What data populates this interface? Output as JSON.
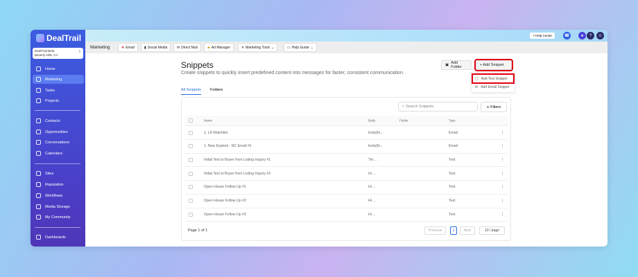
{
  "app": {
    "name": "DealTrail",
    "account_name": "DealTrail Beta",
    "account_location": "Beverly Hills, CA"
  },
  "sidebar": {
    "items": [
      {
        "label": "Home"
      },
      {
        "label": "Marketing"
      },
      {
        "label": "Tasks"
      },
      {
        "label": "Projects"
      },
      {
        "label": "Contacts"
      },
      {
        "label": "Opportunities"
      },
      {
        "label": "Conversations"
      },
      {
        "label": "Calendars"
      },
      {
        "label": "Sites"
      },
      {
        "label": "Reputation"
      },
      {
        "label": "Workflows"
      },
      {
        "label": "Media Storage"
      },
      {
        "label": "My Community"
      },
      {
        "label": "Dashboards"
      }
    ]
  },
  "topbar": {
    "help_center": "? Help Center"
  },
  "toolbar": {
    "section": "Marketing",
    "buttons": [
      {
        "label": "Email"
      },
      {
        "label": "Social Media"
      },
      {
        "label": "Direct Mail"
      },
      {
        "label": "Ad Manager"
      },
      {
        "label": "Marketing Tools"
      },
      {
        "label": "Help Guide"
      }
    ]
  },
  "page": {
    "title": "Snippets",
    "subtitle": "Create snippets to quickly insert predefined content into messages for faster, consistent communication.",
    "add_folder": "Add Folder",
    "add_snippet": "+ Add Snippet",
    "menu": [
      "Add Text Snippet",
      "Add Email Snippet"
    ],
    "tabs": [
      "All Snippets",
      "Folders"
    ]
  },
  "table": {
    "search_placeholder": "Search Snippets",
    "filters": "Filters",
    "columns": [
      "Name",
      "Body",
      "Folder",
      "Type"
    ],
    "rows": [
      {
        "name": "1. LA Watchlist",
        "body": "body{fo...",
        "type": "Email"
      },
      {
        "name": "1. New Expired - NC Email #1",
        "body": "body{fo...",
        "type": "Email"
      },
      {
        "name": "Initial Text to Buyer from Listing Inquiry #1",
        "body": "\"Hi ...",
        "type": "Text"
      },
      {
        "name": "Initial Text to Buyer from Listing Inquiry #2",
        "body": "Hi ...",
        "type": "Text"
      },
      {
        "name": "Open House Follow Up #1",
        "body": "Hi ...",
        "type": "Text"
      },
      {
        "name": "Open House Follow Up #2",
        "body": "Hi ...",
        "type": "Text"
      },
      {
        "name": "Open House Follow Up #3",
        "body": "Hi ...",
        "type": "Text"
      }
    ],
    "page_info": "Page 1 of 1",
    "previous": "Previous",
    "current_page": "1",
    "next": "Next",
    "page_size": "10 / page"
  }
}
